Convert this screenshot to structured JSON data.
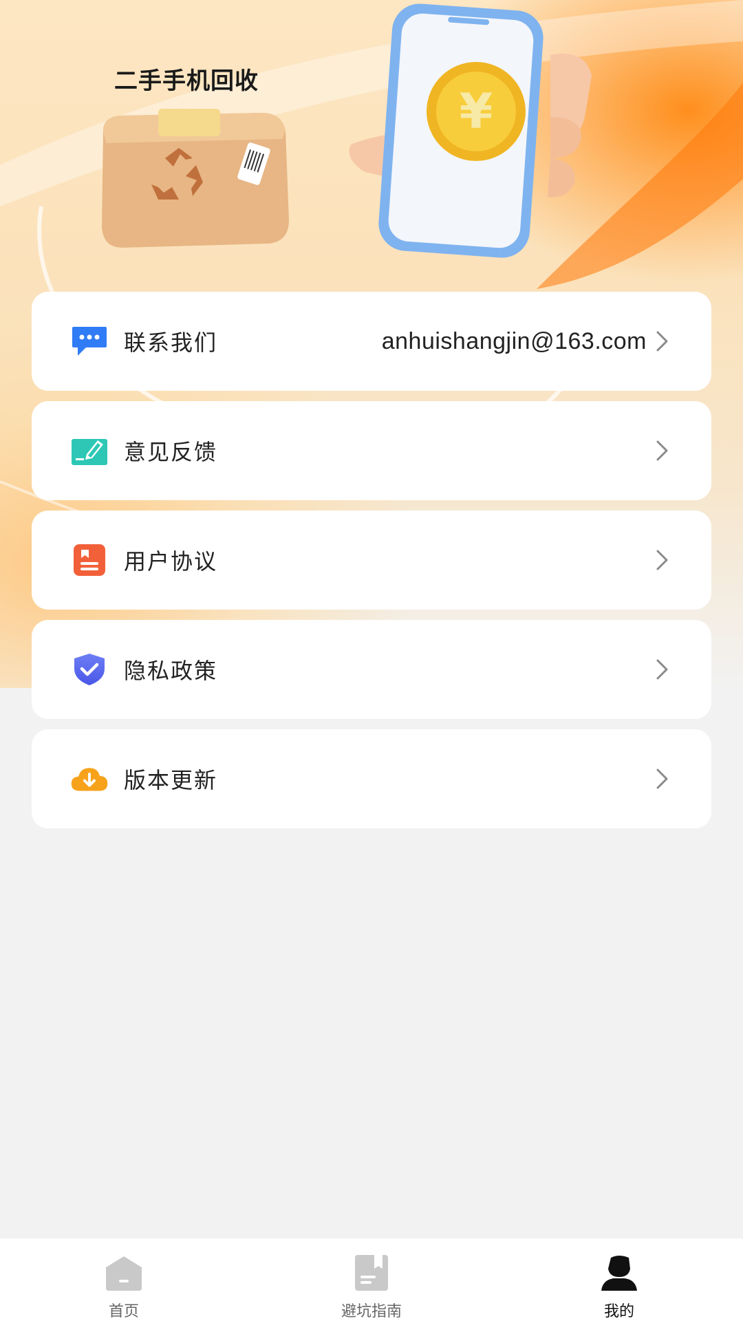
{
  "banner": {
    "title": "二手手机回收"
  },
  "menu": {
    "items": [
      {
        "label": "联系我们",
        "value": "anhuishangjin@163.com",
        "icon": "chat-bubble-icon",
        "icon_color": "#2f7cf6"
      },
      {
        "label": "意见反馈",
        "value": "",
        "icon": "feedback-edit-icon",
        "icon_color": "#2ec7b6"
      },
      {
        "label": "用户协议",
        "value": "",
        "icon": "document-icon",
        "icon_color": "#f2603a"
      },
      {
        "label": "隐私政策",
        "value": "",
        "icon": "shield-check-icon",
        "icon_color": "#5b6cf0"
      },
      {
        "label": "版本更新",
        "value": "",
        "icon": "cloud-download-icon",
        "icon_color": "#f7a21b"
      }
    ]
  },
  "tabbar": {
    "tabs": [
      {
        "label": "首页",
        "icon": "home-icon",
        "active": false
      },
      {
        "label": "避坑指南",
        "icon": "guide-book-icon",
        "active": false
      },
      {
        "label": "我的",
        "icon": "user-profile-icon",
        "active": true
      }
    ]
  },
  "colors": {
    "background": "#f2f2f2",
    "banner_accent": "#ff8a14",
    "tab_inactive": "#c9c9c9",
    "tab_active": "#111111"
  }
}
